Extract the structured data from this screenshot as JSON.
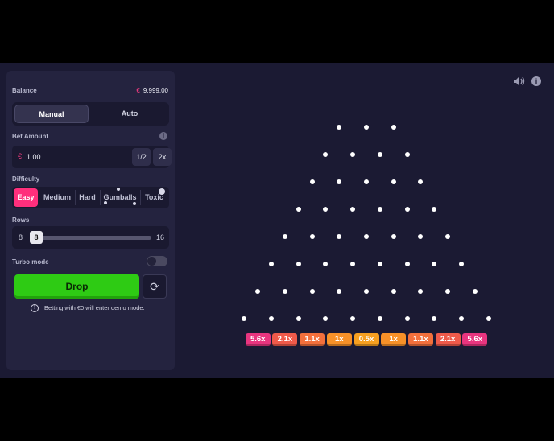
{
  "panel": {
    "balance_label": "Balance",
    "balance_currency": "€",
    "balance_value": "9,999.00",
    "modes": {
      "manual": "Manual",
      "auto": "Auto",
      "selected": "Manual"
    },
    "bet_amount_label": "Bet Amount",
    "bet_currency": "€",
    "bet_value": "1.00",
    "bet_half_label": "1/2",
    "bet_double_label": "2x",
    "difficulty_label": "Difficulty",
    "difficulties": [
      "Easy",
      "Medium",
      "Hard",
      "Gumballs",
      "Toxic"
    ],
    "difficulty_selected": "Easy",
    "rows_label": "Rows",
    "rows_min": "8",
    "rows_max": "16",
    "rows_value": "8",
    "turbo_label": "Turbo mode",
    "turbo_on": false,
    "drop_label": "Drop",
    "notice": "Betting with €0 will enter demo mode."
  },
  "board": {
    "rows": 8,
    "multipliers": [
      "5.6x",
      "2.1x",
      "1.1x",
      "1x",
      "0.5x",
      "1x",
      "1.1x",
      "2.1x",
      "5.6x"
    ],
    "bucket_colors": [
      "#e8357f",
      "#ef5a4a",
      "#f3703c",
      "#f79128",
      "#f7a020",
      "#f79128",
      "#f3703c",
      "#ef5a4a",
      "#e8357f"
    ]
  },
  "colors": {
    "accent": "#ff2f7c",
    "drop_button": "#2ecb14",
    "background": "#1b1a33",
    "panel": "#24233f"
  },
  "icons": {
    "volume": "volume-icon",
    "help": "info-icon",
    "refresh": "refresh-icon"
  }
}
